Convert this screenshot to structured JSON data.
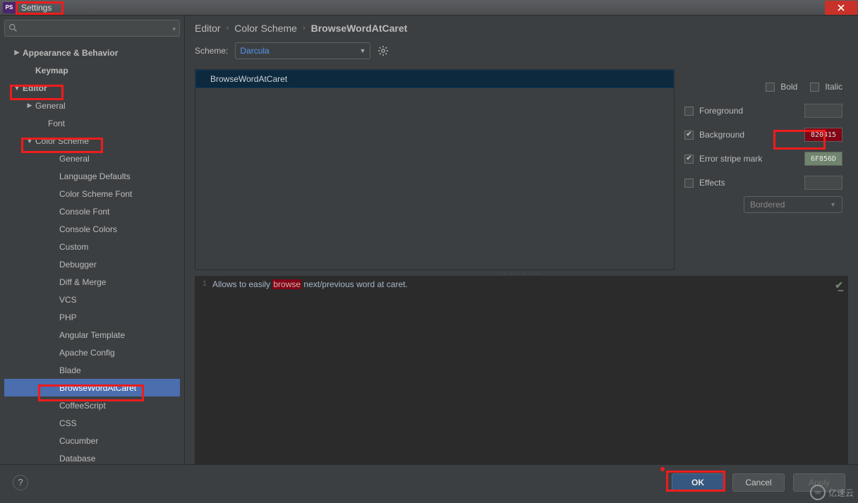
{
  "window": {
    "title": "Settings"
  },
  "search": {
    "placeholder": ""
  },
  "tree": [
    {
      "label": "Appearance & Behavior",
      "level": 0,
      "bold": true,
      "arrow": "▶"
    },
    {
      "label": "Keymap",
      "level": 1,
      "bold": true
    },
    {
      "label": "Editor",
      "level": 0,
      "bold": true,
      "arrow": "▼"
    },
    {
      "label": "General",
      "level": 1,
      "arrow": "▶"
    },
    {
      "label": "Font",
      "level": 2
    },
    {
      "label": "Color Scheme",
      "level": 1,
      "arrow": "▼"
    },
    {
      "label": "General",
      "level": 3
    },
    {
      "label": "Language Defaults",
      "level": 3
    },
    {
      "label": "Color Scheme Font",
      "level": 3
    },
    {
      "label": "Console Font",
      "level": 3
    },
    {
      "label": "Console Colors",
      "level": 3
    },
    {
      "label": "Custom",
      "level": 3
    },
    {
      "label": "Debugger",
      "level": 3
    },
    {
      "label": "Diff & Merge",
      "level": 3
    },
    {
      "label": "VCS",
      "level": 3
    },
    {
      "label": "PHP",
      "level": 3
    },
    {
      "label": "Angular Template",
      "level": 3
    },
    {
      "label": "Apache Config",
      "level": 3
    },
    {
      "label": "Blade",
      "level": 3
    },
    {
      "label": "BrowseWordAtCaret",
      "level": 3,
      "selected": true
    },
    {
      "label": "CoffeeScript",
      "level": 3
    },
    {
      "label": "CSS",
      "level": 3
    },
    {
      "label": "Cucumber",
      "level": 3
    },
    {
      "label": "Database",
      "level": 3
    }
  ],
  "breadcrumb": {
    "a": "Editor",
    "b": "Color Scheme",
    "c": "BrowseWordAtCaret"
  },
  "scheme": {
    "label": "Scheme:",
    "value": "Darcula"
  },
  "list": {
    "item0": "BrowseWordAtCaret"
  },
  "attrs": {
    "bold": "Bold",
    "italic": "Italic",
    "foreground": "Foreground",
    "background": "Background",
    "background_hex": "820415",
    "errorstripe": "Error stripe mark",
    "errorstripe_hex": "6F856D",
    "effects": "Effects",
    "effects_type": "Bordered"
  },
  "preview": {
    "line_no": "1",
    "before": "Allows to easily ",
    "word": "browse",
    "after": " next/previous word at caret."
  },
  "buttons": {
    "ok": "OK",
    "cancel": "Cancel",
    "apply": "Apply",
    "help": "?"
  },
  "watermark": "亿速云"
}
